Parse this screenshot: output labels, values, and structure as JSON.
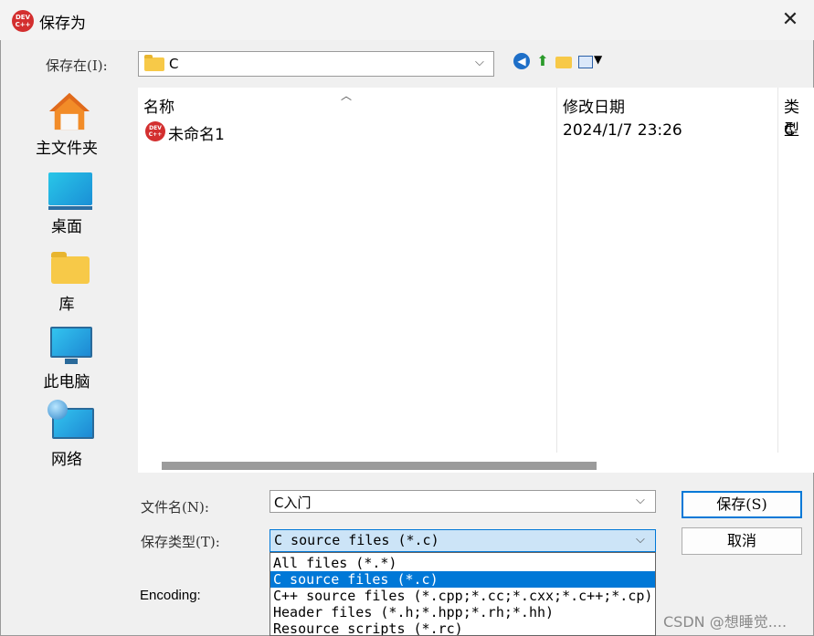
{
  "window": {
    "title": "保存为",
    "app_logo_text": "DEV C++",
    "close_glyph": "✕"
  },
  "toolbar": {
    "save_in_label": "保存在(I):",
    "save_in_value": "C",
    "chevron": "⌵"
  },
  "places": [
    {
      "label": "主文件夹",
      "icon": "home-icon"
    },
    {
      "label": "桌面",
      "icon": "desktop-icon"
    },
    {
      "label": "库",
      "icon": "library-folder-icon"
    },
    {
      "label": "此电脑",
      "icon": "computer-icon"
    },
    {
      "label": "网络",
      "icon": "network-icon"
    }
  ],
  "file_list": {
    "columns": [
      "名称",
      "修改日期",
      "类型"
    ],
    "rows": [
      {
        "name": "未命名1",
        "modified": "2024/1/7 23:26",
        "type": "C 文"
      }
    ]
  },
  "form": {
    "filename_label": "文件名(N):",
    "filename_value": "C入门",
    "filetype_label": "保存类型(T):",
    "filetype_value": "C source files (*.c)",
    "encoding_label": "Encoding:",
    "save_button": "保存(S)",
    "cancel_button": "取消"
  },
  "filetype_options": [
    {
      "label": "All files (*.*)",
      "selected": false
    },
    {
      "label": "C source files (*.c)",
      "selected": true
    },
    {
      "label": "C++ source files (*.cpp;*.cc;*.cxx;*.c++;*.cp)",
      "selected": false
    },
    {
      "label": "Header files (*.h;*.hpp;*.rh;*.hh)",
      "selected": false
    },
    {
      "label": "Resource scripts (*.rc)",
      "selected": false
    }
  ],
  "watermark": "CSDN @想睡觉....",
  "colors": {
    "accent": "#0078d7",
    "selected_bg": "#cce4f7",
    "dev_logo": "#d32f2f"
  }
}
